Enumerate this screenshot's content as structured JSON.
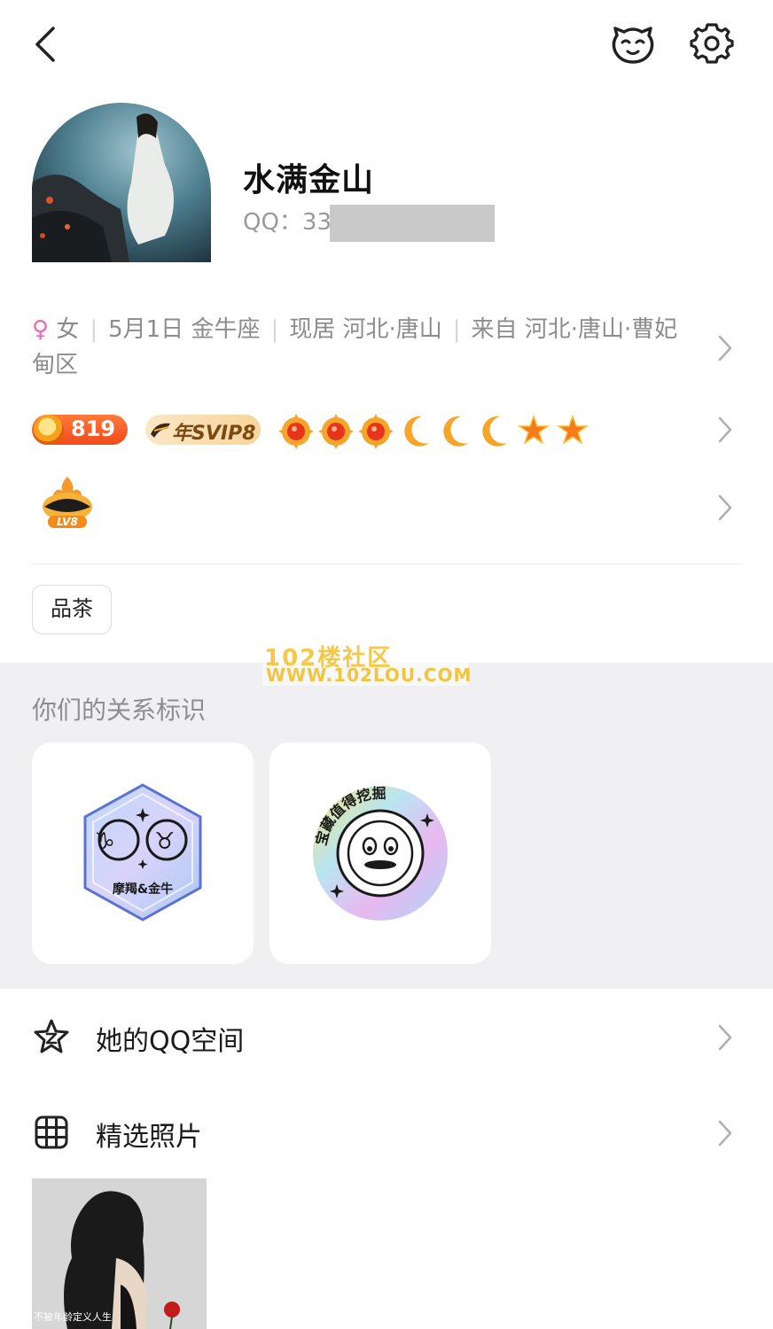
{
  "header": {
    "back_icon": "chevron-left-icon",
    "pet_icon": "pet-face-icon",
    "settings_icon": "gear-icon"
  },
  "profile": {
    "nickname": "水满金山",
    "qq_label": "QQ：33"
  },
  "info": {
    "gender_symbol": "♀",
    "gender": "女",
    "birthday": "5月1日 金牛座",
    "residence": "现居 河北·唐山",
    "hometown": "来自 河北·唐山·曹妃甸区"
  },
  "badges": {
    "coin_value": "819",
    "svip_label": "年SVIP8"
  },
  "level_badge": {
    "label": "LV8"
  },
  "tags": [
    "品茶"
  ],
  "watermark": {
    "line1": "102楼社区",
    "line2": "WWW.102LOU.COM"
  },
  "relation": {
    "title": "你们的关系标识",
    "cards": [
      {
        "label": "摩羯&金牛",
        "symbols": "♑ ♉"
      },
      {
        "label": "宝藏值得挖掘"
      }
    ]
  },
  "menu": {
    "qzone_label": "她的QQ空间",
    "photos_label": "精选照片"
  },
  "photo": {
    "caption": "不被年龄定义人生"
  },
  "colors": {
    "accent_pink": "#f06aa8",
    "gray_bg": "#f0f0f2",
    "watermark_yellow": "#f5c84a"
  }
}
